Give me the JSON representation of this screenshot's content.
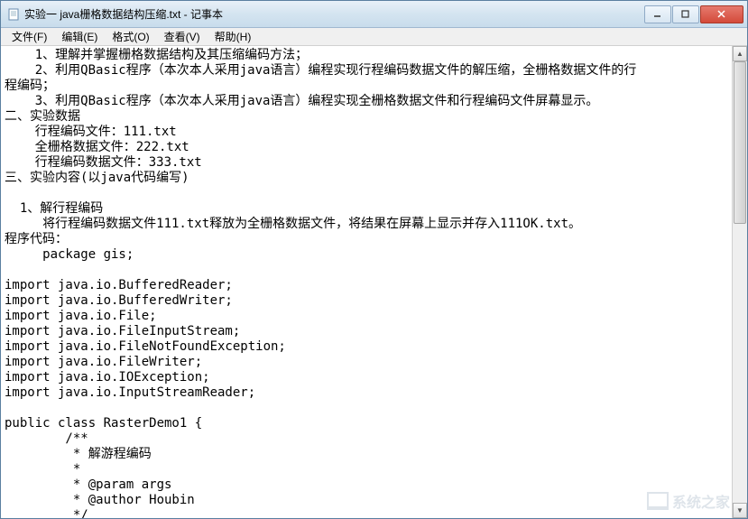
{
  "titlebar": {
    "title": "实验一 java栅格数据结构压缩.txt - 记事本"
  },
  "menubar": {
    "file": "文件(F)",
    "edit": "编辑(E)",
    "format": "格式(O)",
    "view": "查看(V)",
    "help": "帮助(H)"
  },
  "content": {
    "text": "    1、理解并掌握栅格数据结构及其压缩编码方法；\n    2、利用QBasic程序（本次本人采用java语言）编程实现行程编码数据文件的解压缩，全栅格数据文件的行\n程编码；\n    3、利用QBasic程序（本次本人采用java语言）编程实现全栅格数据文件和行程编码文件屏幕显示。\n二、实验数据\n    行程编码文件：111.txt\n    全栅格数据文件：222.txt\n    行程编码数据文件：333.txt\n三、实验内容(以java代码编写)\n\n  1、解行程编码\n     将行程编码数据文件111.txt释放为全栅格数据文件，将结果在屏幕上显示并存入111OK.txt。\n程序代码：\n     package gis;\n\nimport java.io.BufferedReader;\nimport java.io.BufferedWriter;\nimport java.io.File;\nimport java.io.FileInputStream;\nimport java.io.FileNotFoundException;\nimport java.io.FileWriter;\nimport java.io.IOException;\nimport java.io.InputStreamReader;\n\npublic class RasterDemo1 {\n        /**\n         * 解游程编码\n         * \n         * @param args\n         * @author Houbin\n         */"
  },
  "watermark": {
    "text": "系统之家"
  }
}
